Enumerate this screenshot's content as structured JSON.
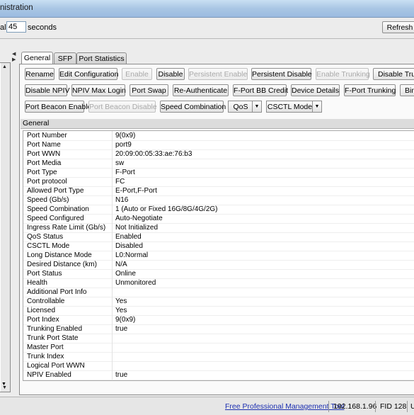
{
  "window": {
    "title": "nistration"
  },
  "refresh_bar": {
    "interval_label": "al",
    "interval_value": "45",
    "unit_label": "seconds",
    "refresh_button": "Refresh"
  },
  "tabs": [
    {
      "label": "General",
      "active": true
    },
    {
      "label": "SFP",
      "active": false
    },
    {
      "label": "Port Statistics",
      "active": false
    }
  ],
  "toolbar": {
    "row1": [
      {
        "label": "Rename",
        "enabled": true
      },
      {
        "label": "Edit Configuration",
        "enabled": true
      },
      {
        "label": "Enable",
        "enabled": false
      },
      {
        "label": "Disable",
        "enabled": true
      },
      {
        "label": "Persistent Enable",
        "enabled": false
      },
      {
        "label": "Persistent Disable",
        "enabled": true
      },
      {
        "label": "Enable Trunking",
        "enabled": false
      },
      {
        "label": "Disable Trunk",
        "enabled": true
      }
    ],
    "row2": [
      {
        "label": "Disable NPIV",
        "enabled": true
      },
      {
        "label": "NPIV Max Login",
        "enabled": true
      },
      {
        "label": "Port Swap",
        "enabled": true
      },
      {
        "label": "Re-Authenticate",
        "enabled": true
      },
      {
        "label": "F-Port BB Credit",
        "enabled": true
      },
      {
        "label": "Device Details",
        "enabled": true
      },
      {
        "label": "F-Port Trunking",
        "enabled": true
      },
      {
        "label": "Bin",
        "enabled": true
      }
    ],
    "row3": [
      {
        "label": "Port Beacon Enable",
        "enabled": true
      },
      {
        "label": "Port Beacon Disable",
        "enabled": false
      },
      {
        "label": "Speed Combination",
        "enabled": true
      }
    ],
    "qos_dropdown": "QoS",
    "csctl_dropdown": "CSCTL Mode"
  },
  "section_title": "General",
  "properties": [
    {
      "name": "Port Number",
      "value": "9(0x9)"
    },
    {
      "name": "Port Name",
      "value": "port9"
    },
    {
      "name": "Port WWN",
      "value": "20:09:00:05:33:ae:76:b3"
    },
    {
      "name": "Port Media",
      "value": "sw"
    },
    {
      "name": "Port Type",
      "value": "F-Port"
    },
    {
      "name": "Port protocol",
      "value": "FC"
    },
    {
      "name": "Allowed Port Type",
      "value": "E-Port,F-Port"
    },
    {
      "name": "Speed (Gb/s)",
      "value": "N16"
    },
    {
      "name": "Speed Combination",
      "value": "1 (Auto or Fixed 16G/8G/4G/2G)"
    },
    {
      "name": "Speed Configured",
      "value": "Auto-Negotiate"
    },
    {
      "name": "Ingress Rate Limit (Gb/s)",
      "value": "Not Initialized"
    },
    {
      "name": "QoS Status",
      "value": "Enabled"
    },
    {
      "name": "CSCTL Mode",
      "value": "Disabled"
    },
    {
      "name": "Long Distance Mode",
      "value": "L0:Normal"
    },
    {
      "name": "Desired Distance (km)",
      "value": "N/A"
    },
    {
      "name": "Port Status",
      "value": "Online"
    },
    {
      "name": "Health",
      "value": "Unmonitored"
    },
    {
      "name": "Additional Port Info",
      "value": ""
    },
    {
      "name": "Controllable",
      "value": "Yes"
    },
    {
      "name": "Licensed",
      "value": "Yes"
    },
    {
      "name": "Port Index",
      "value": "9(0x9)"
    },
    {
      "name": "Trunking Enabled",
      "value": "true"
    },
    {
      "name": "Trunk Port State",
      "value": ""
    },
    {
      "name": "Master Port",
      "value": ""
    },
    {
      "name": "Trunk Index",
      "value": ""
    },
    {
      "name": "Logical Port WWN",
      "value": ""
    },
    {
      "name": "NPIV Enabled",
      "value": "true"
    }
  ],
  "statusbar": {
    "link": "Free Professional Management Tool",
    "ip": "192.168.1.96",
    "fid": "FID 128",
    "user": "U"
  }
}
